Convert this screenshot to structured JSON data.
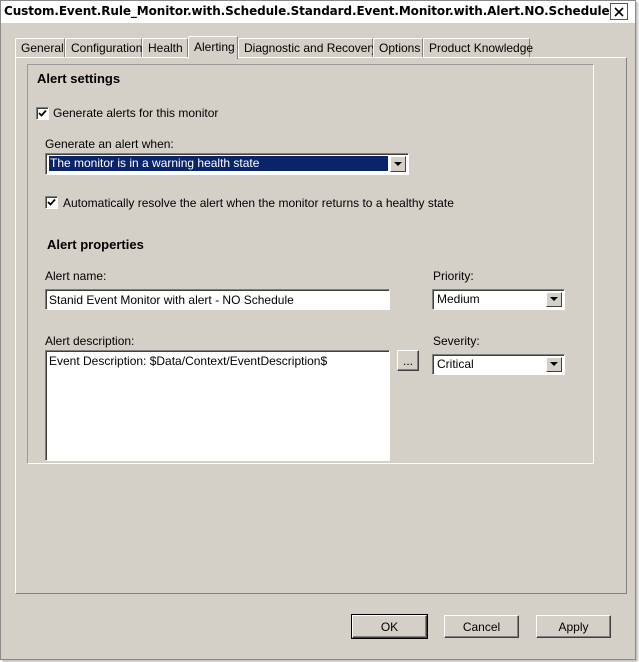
{
  "window": {
    "title": "Custom.Event.Rule_Monitor.with.Schedule.Standard.Event.Monitor.with.Alert.NO.Schedule",
    "close_icon": "close-icon"
  },
  "tabs": [
    {
      "label": "General"
    },
    {
      "label": "Configuration"
    },
    {
      "label": "Health"
    },
    {
      "label": "Alerting",
      "active": true
    },
    {
      "label": "Diagnostic and Recovery"
    },
    {
      "label": "Options"
    },
    {
      "label": "Product Knowledge"
    }
  ],
  "alert_settings": {
    "title": "Alert settings",
    "generate_alerts": {
      "label": "Generate alerts for this monitor",
      "checked": true
    },
    "generate_when_label": "Generate an alert when:",
    "generate_when_value": "The monitor is in a warning health state",
    "auto_resolve": {
      "label": "Automatically resolve the alert when the monitor returns to a healthy state",
      "checked": true
    }
  },
  "alert_properties": {
    "title": "Alert properties",
    "name_label": "Alert name:",
    "name_value": "Stanid Event Monitor with alert - NO Schedule",
    "priority_label": "Priority:",
    "priority_value": "Medium",
    "description_label": "Alert description:",
    "description_value": "Event Description: $Data/Context/EventDescription$",
    "browse_label": "...",
    "severity_label": "Severity:",
    "severity_value": "Critical"
  },
  "buttons": {
    "ok": "OK",
    "cancel": "Cancel",
    "apply": "Apply"
  },
  "colors": {
    "dialog_bg": "#d4d0c8",
    "selection": "#0a246a"
  }
}
